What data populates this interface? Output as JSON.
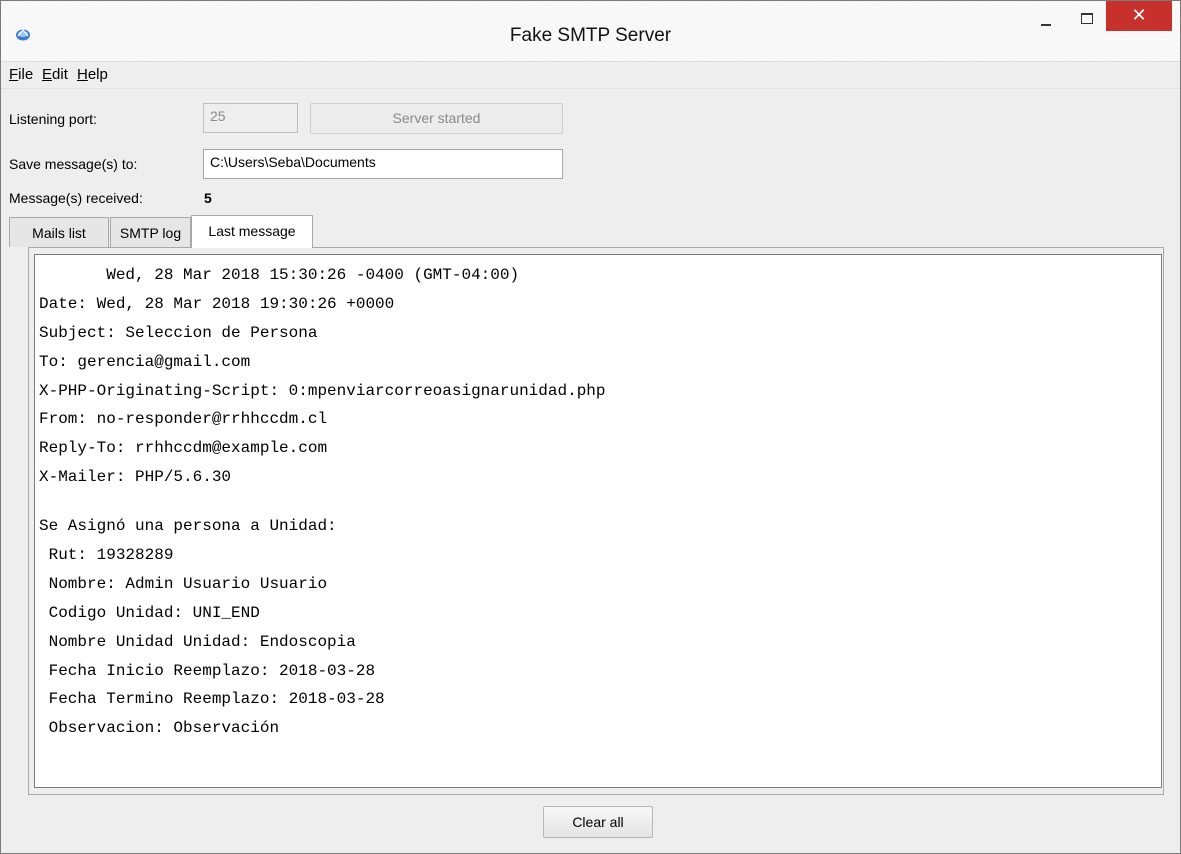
{
  "window": {
    "title": "Fake SMTP Server",
    "close_glyph": "✕"
  },
  "menu": {
    "file": {
      "accel": "F",
      "rest": "ile"
    },
    "edit": {
      "accel": "E",
      "rest": "dit"
    },
    "help": {
      "accel": "H",
      "rest": "elp"
    }
  },
  "form": {
    "port_label": "Listening port:",
    "port_value": "25",
    "server_button": "Server started",
    "save_label": "Save message(s) to:",
    "save_path": "C:\\Users\\Seba\\Documents",
    "received_label": "Message(s) received:",
    "received_count": "5"
  },
  "tabs": [
    {
      "label": "Mails list"
    },
    {
      "label": "SMTP log"
    },
    {
      "label": "Last message"
    }
  ],
  "message": {
    "header_lines": [
      "       Wed, 28 Mar 2018 15:30:26 -0400 (GMT-04:00)",
      "Date: Wed, 28 Mar 2018 19:30:26 +0000",
      "Subject: Seleccion de Persona",
      "To: gerencia@gmail.com",
      "X-PHP-Originating-Script: 0:mpenviarcorreoasignarunidad.php",
      "From: no-responder@rrhhccdm.cl",
      "Reply-To: rrhhccdm@example.com",
      "X-Mailer: PHP/5.6.30"
    ],
    "body_lines": [
      "Se Asignó una persona a Unidad:",
      " Rut: 19328289",
      " Nombre: Admin Usuario Usuario",
      " Codigo Unidad: UNI_END",
      " Nombre Unidad Unidad: Endoscopia",
      " Fecha Inicio Reemplazo: 2018-03-28",
      " Fecha Termino Reemplazo: 2018-03-28",
      " Observacion: Observación"
    ]
  },
  "footer": {
    "clear_button": "Clear all"
  },
  "colors": {
    "close_button": "#c7302b",
    "window_bg": "#eeeeee"
  },
  "icons": {
    "app": "app-icon",
    "minimize": "minimize-icon",
    "maximize": "maximize-icon",
    "close": "close-icon"
  }
}
